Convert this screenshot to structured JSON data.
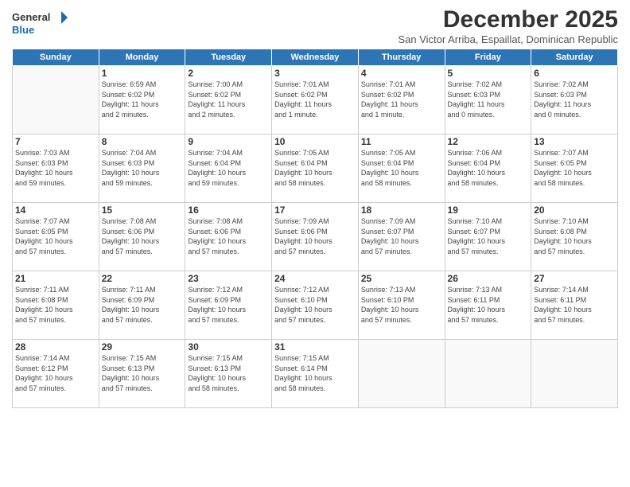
{
  "logo": {
    "line1": "General",
    "line2": "Blue"
  },
  "title": "December 2025",
  "subtitle": "San Victor Arriba, Espaillat, Dominican Republic",
  "weekdays": [
    "Sunday",
    "Monday",
    "Tuesday",
    "Wednesday",
    "Thursday",
    "Friday",
    "Saturday"
  ],
  "weeks": [
    [
      {
        "day": "",
        "info": ""
      },
      {
        "day": "1",
        "info": "Sunrise: 6:59 AM\nSunset: 6:02 PM\nDaylight: 11 hours\nand 2 minutes."
      },
      {
        "day": "2",
        "info": "Sunrise: 7:00 AM\nSunset: 6:02 PM\nDaylight: 11 hours\nand 2 minutes."
      },
      {
        "day": "3",
        "info": "Sunrise: 7:01 AM\nSunset: 6:02 PM\nDaylight: 11 hours\nand 1 minute."
      },
      {
        "day": "4",
        "info": "Sunrise: 7:01 AM\nSunset: 6:02 PM\nDaylight: 11 hours\nand 1 minute."
      },
      {
        "day": "5",
        "info": "Sunrise: 7:02 AM\nSunset: 6:03 PM\nDaylight: 11 hours\nand 0 minutes."
      },
      {
        "day": "6",
        "info": "Sunrise: 7:02 AM\nSunset: 6:03 PM\nDaylight: 11 hours\nand 0 minutes."
      }
    ],
    [
      {
        "day": "7",
        "info": "Sunrise: 7:03 AM\nSunset: 6:03 PM\nDaylight: 10 hours\nand 59 minutes."
      },
      {
        "day": "8",
        "info": "Sunrise: 7:04 AM\nSunset: 6:03 PM\nDaylight: 10 hours\nand 59 minutes."
      },
      {
        "day": "9",
        "info": "Sunrise: 7:04 AM\nSunset: 6:04 PM\nDaylight: 10 hours\nand 59 minutes."
      },
      {
        "day": "10",
        "info": "Sunrise: 7:05 AM\nSunset: 6:04 PM\nDaylight: 10 hours\nand 58 minutes."
      },
      {
        "day": "11",
        "info": "Sunrise: 7:05 AM\nSunset: 6:04 PM\nDaylight: 10 hours\nand 58 minutes."
      },
      {
        "day": "12",
        "info": "Sunrise: 7:06 AM\nSunset: 6:04 PM\nDaylight: 10 hours\nand 58 minutes."
      },
      {
        "day": "13",
        "info": "Sunrise: 7:07 AM\nSunset: 6:05 PM\nDaylight: 10 hours\nand 58 minutes."
      }
    ],
    [
      {
        "day": "14",
        "info": "Sunrise: 7:07 AM\nSunset: 6:05 PM\nDaylight: 10 hours\nand 57 minutes."
      },
      {
        "day": "15",
        "info": "Sunrise: 7:08 AM\nSunset: 6:06 PM\nDaylight: 10 hours\nand 57 minutes."
      },
      {
        "day": "16",
        "info": "Sunrise: 7:08 AM\nSunset: 6:06 PM\nDaylight: 10 hours\nand 57 minutes."
      },
      {
        "day": "17",
        "info": "Sunrise: 7:09 AM\nSunset: 6:06 PM\nDaylight: 10 hours\nand 57 minutes."
      },
      {
        "day": "18",
        "info": "Sunrise: 7:09 AM\nSunset: 6:07 PM\nDaylight: 10 hours\nand 57 minutes."
      },
      {
        "day": "19",
        "info": "Sunrise: 7:10 AM\nSunset: 6:07 PM\nDaylight: 10 hours\nand 57 minutes."
      },
      {
        "day": "20",
        "info": "Sunrise: 7:10 AM\nSunset: 6:08 PM\nDaylight: 10 hours\nand 57 minutes."
      }
    ],
    [
      {
        "day": "21",
        "info": "Sunrise: 7:11 AM\nSunset: 6:08 PM\nDaylight: 10 hours\nand 57 minutes."
      },
      {
        "day": "22",
        "info": "Sunrise: 7:11 AM\nSunset: 6:09 PM\nDaylight: 10 hours\nand 57 minutes."
      },
      {
        "day": "23",
        "info": "Sunrise: 7:12 AM\nSunset: 6:09 PM\nDaylight: 10 hours\nand 57 minutes."
      },
      {
        "day": "24",
        "info": "Sunrise: 7:12 AM\nSunset: 6:10 PM\nDaylight: 10 hours\nand 57 minutes."
      },
      {
        "day": "25",
        "info": "Sunrise: 7:13 AM\nSunset: 6:10 PM\nDaylight: 10 hours\nand 57 minutes."
      },
      {
        "day": "26",
        "info": "Sunrise: 7:13 AM\nSunset: 6:11 PM\nDaylight: 10 hours\nand 57 minutes."
      },
      {
        "day": "27",
        "info": "Sunrise: 7:14 AM\nSunset: 6:11 PM\nDaylight: 10 hours\nand 57 minutes."
      }
    ],
    [
      {
        "day": "28",
        "info": "Sunrise: 7:14 AM\nSunset: 6:12 PM\nDaylight: 10 hours\nand 57 minutes."
      },
      {
        "day": "29",
        "info": "Sunrise: 7:15 AM\nSunset: 6:13 PM\nDaylight: 10 hours\nand 57 minutes."
      },
      {
        "day": "30",
        "info": "Sunrise: 7:15 AM\nSunset: 6:13 PM\nDaylight: 10 hours\nand 58 minutes."
      },
      {
        "day": "31",
        "info": "Sunrise: 7:15 AM\nSunset: 6:14 PM\nDaylight: 10 hours\nand 58 minutes."
      },
      {
        "day": "",
        "info": ""
      },
      {
        "day": "",
        "info": ""
      },
      {
        "day": "",
        "info": ""
      }
    ]
  ]
}
